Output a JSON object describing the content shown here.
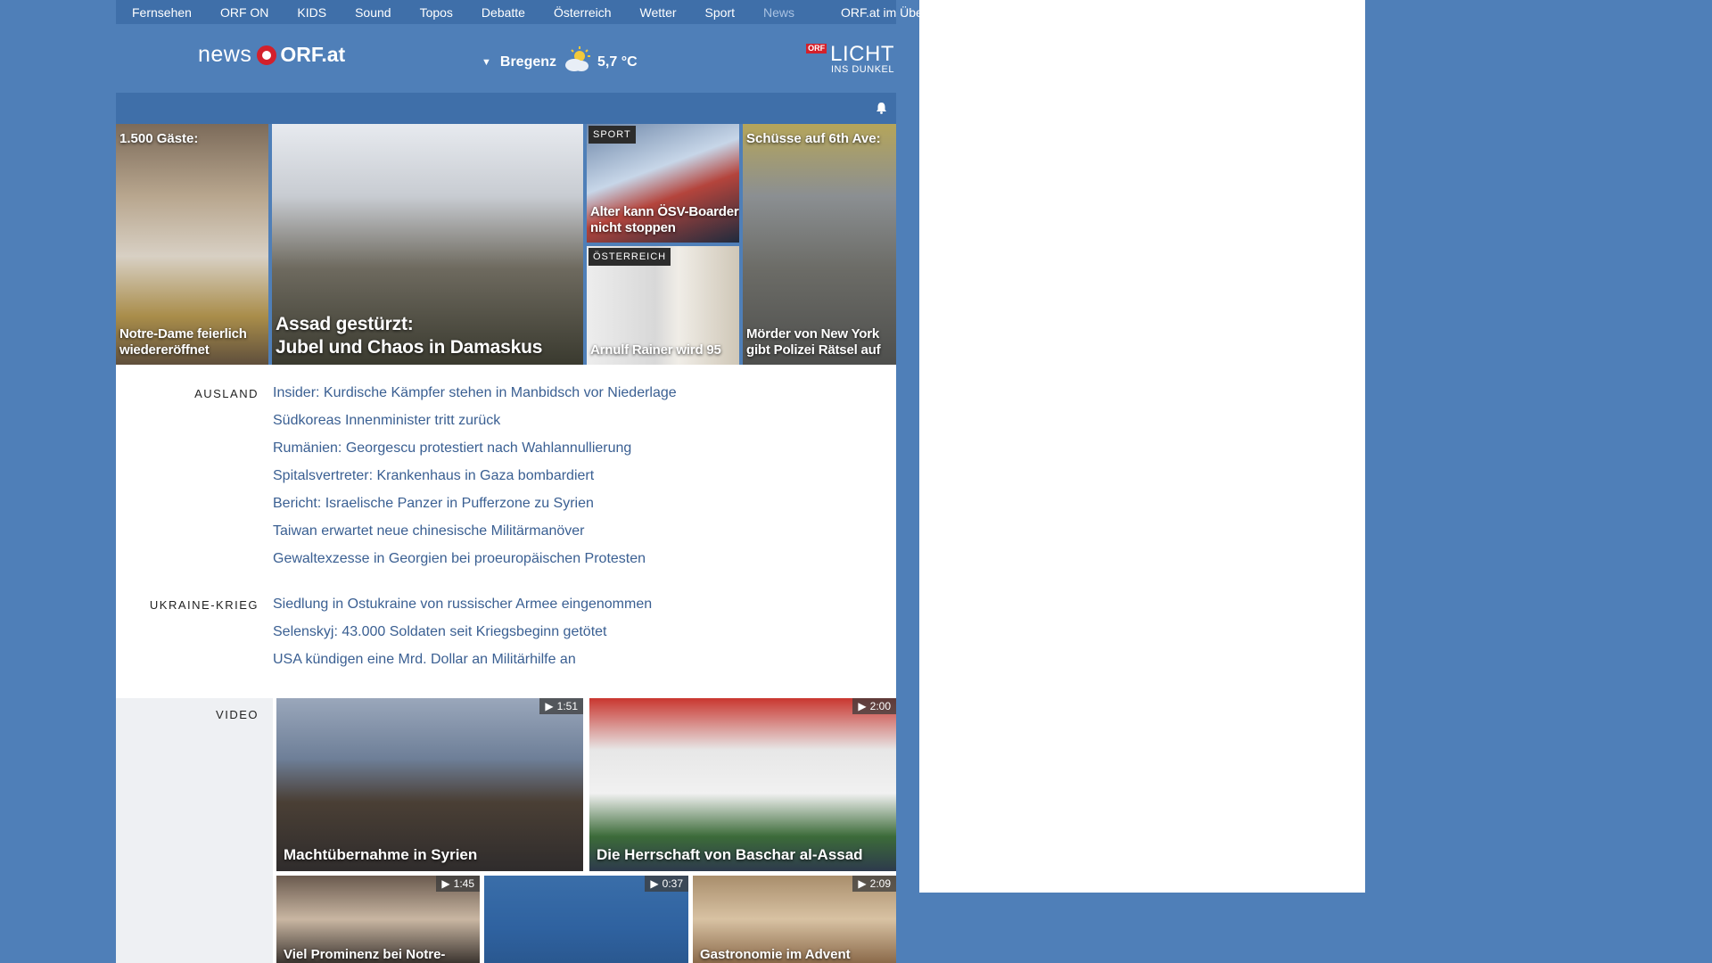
{
  "nav": {
    "items": [
      "Fernsehen",
      "ORF ON",
      "KIDS",
      "Sound",
      "Topos",
      "Debatte",
      "Österreich",
      "Wetter",
      "Sport",
      "News"
    ],
    "overview": "ORF.at im Überblick"
  },
  "header": {
    "logo_news": "news",
    "logo_orf": "ORF.at",
    "weather_location": "Bregenz",
    "weather_temp": "5,7 °C",
    "licht_badge": "ORF",
    "licht_big": "LICHT",
    "licht_small": "INS DUNKEL"
  },
  "teasers": {
    "t1_top": "1.500 Gäste:",
    "t1_caption": "Notre-Dame feierlich wiedereröffnet",
    "t2_caption_line1": "Assad gestürzt:",
    "t2_caption_line2": "Jubel und Chaos in Damaskus",
    "t3_tag": "SPORT",
    "t3_caption": "Alter kann ÖSV-Boarder nicht stoppen",
    "t4_tag": "ÖSTERREICH",
    "t4_caption": "Arnulf Rainer wird 95",
    "t5_top": "Schüsse auf 6th Ave:",
    "t5_caption": "Mörder von New York gibt Polizei Rätsel auf"
  },
  "sections": {
    "ausland": {
      "label": "AUSLAND",
      "links": [
        "Insider: Kurdische Kämpfer stehen in Manbidsch vor Niederlage",
        "Südkoreas Innenminister tritt zurück",
        "Rumänien: Georgescu protestiert nach Wahlannullierung",
        "Spitalsvertreter: Krankenhaus in Gaza bombardiert",
        "Bericht: Israelische Panzer in Pufferzone zu Syrien",
        "Taiwan erwartet neue chinesische Militärmanöver",
        "Gewaltexzesse in Georgien bei proeuropäischen Protesten"
      ]
    },
    "ukraine": {
      "label": "UKRAINE-KRIEG",
      "links": [
        "Siedlung in Ostukraine von russischer Armee eingenommen",
        "Selenskyj: 43.000 Soldaten seit Kriegsbeginn getötet",
        "USA kündigen eine Mrd. Dollar an Militärhilfe an"
      ]
    }
  },
  "video": {
    "label": "VIDEO",
    "items": [
      {
        "duration": "1:51",
        "caption": "Machtübernahme in Syrien"
      },
      {
        "duration": "2:00",
        "caption": "Die Herrschaft von Baschar al-Assad"
      },
      {
        "duration": "1:45",
        "caption": "Viel Prominenz bei Notre-"
      },
      {
        "duration": "0:37",
        "caption": ""
      },
      {
        "duration": "2:09",
        "caption": "Gastronomie im Advent"
      }
    ]
  },
  "colors": {
    "background": "#4f7fb8",
    "nav_bar": "#3f6fa9",
    "link": "#3a5f92",
    "orf_red": "#d3202b"
  }
}
